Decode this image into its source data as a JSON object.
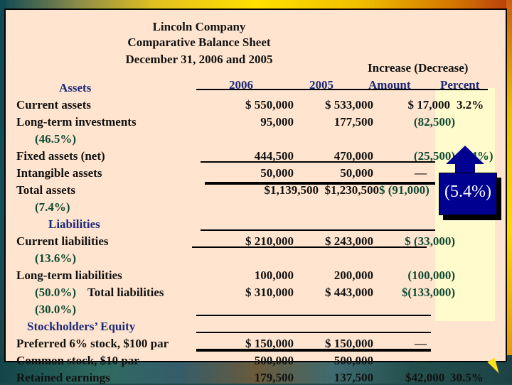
{
  "header": {
    "company": "Lincoln Company",
    "title": "Comparative Balance Sheet",
    "date": "December 31, 2006 and 2005",
    "increase_decrease": "Increase (Decrease)"
  },
  "columns": {
    "y2006": "2006",
    "y2005": "2005",
    "amount": "Amount",
    "percent": "Percent"
  },
  "sections": {
    "assets": "Assets",
    "liabilities": "Liabilities",
    "equity": "Stockholders’ Equity"
  },
  "rows": [
    {
      "label": "Current assets",
      "v2006": "$  550,000",
      "v2005": "$  533,000",
      "amount": "$   17,000",
      "percent": "3.2%"
    },
    {
      "label": "Long-term investments",
      "v2006": "95,000",
      "v2005": "177,500",
      "amount": "(82,500)",
      "percent": "(46.5%)"
    },
    {
      "label": "Fixed assets (net)",
      "v2006": "444,500",
      "v2005": "470,000",
      "amount": "(25,500)",
      "percent": "(5.4%)"
    },
    {
      "label": "Intangible assets",
      "v2006": "50,000",
      "v2005": "50,000",
      "amount": "—",
      "percent": ""
    },
    {
      "label": "Total assets",
      "v2006": "$1,139,500",
      "v2005": "$1,230,500",
      "amount": "$  (91,000)",
      "percent": "(7.4%)"
    },
    {
      "label": "Current liabilities",
      "v2006": "$  210,000",
      "v2005": "$ 243,000",
      "amount": "$  (33,000)",
      "percent": "(13.6%)"
    },
    {
      "label": "Long-term liabilities",
      "v2006": "100,000",
      "v2005": "200,000",
      "amount": "(100,000)",
      "percent": "(50.0%)"
    },
    {
      "label": "Total liabilities",
      "v2006": "$  310,000",
      "v2005": "$ 443,000",
      "amount": "$(133,000)",
      "percent": "(30.0%)"
    },
    {
      "label": "Preferred 6% stock, $100 par",
      "v2006": "$  150,000",
      "v2005": "$ 150,000",
      "amount": "—",
      "percent": ""
    },
    {
      "label": "Common stock, $10 par",
      "v2006": "500,000",
      "v2005": "500,000",
      "amount": "—",
      "percent": ""
    },
    {
      "label": "Retained earnings",
      "v2006": "179,500",
      "v2005": "137,500",
      "amount": "$42,000",
      "percent": "30.5%"
    }
  ],
  "callout": {
    "text": "(5.4%)",
    "color": "#000090"
  },
  "colors": {
    "panel": "#ffe5cf",
    "highlight": "#fffbcc",
    "heading_blue": "#1c2a7a",
    "decrease_green": "#0f4a32"
  }
}
